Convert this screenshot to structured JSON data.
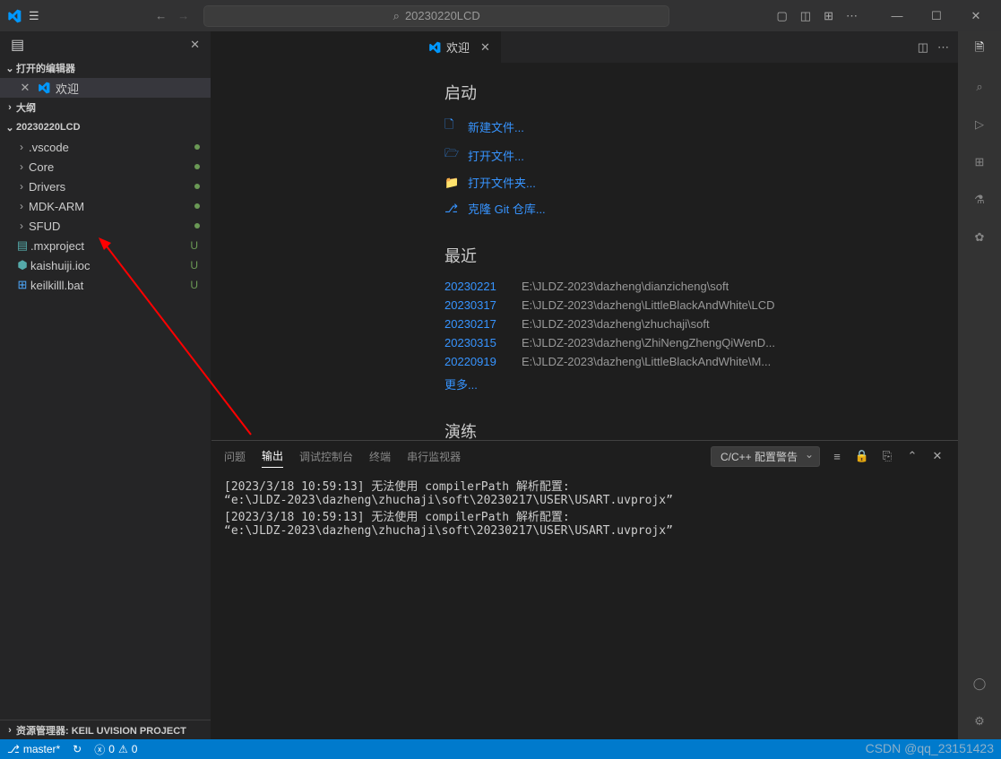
{
  "title": "20230220LCD",
  "search": {
    "placeholder": "20230220LCD"
  },
  "sidebar": {
    "open_editors_label": "打开的编辑器",
    "outline_label": "大纲",
    "project_label": "20230220LCD",
    "open_editor_item": {
      "label": "欢迎"
    },
    "items": [
      {
        "label": ".vscode",
        "type": "folder",
        "status": "dot"
      },
      {
        "label": "Core",
        "type": "folder",
        "status": "dot"
      },
      {
        "label": "Drivers",
        "type": "folder",
        "status": "dot"
      },
      {
        "label": "MDK-ARM",
        "type": "folder",
        "status": "dot"
      },
      {
        "label": "SFUD",
        "type": "folder",
        "status": "dot"
      },
      {
        "label": ".mxproject",
        "type": "file",
        "status": "U"
      },
      {
        "label": "kaishuiji.ioc",
        "type": "file",
        "status": "U"
      },
      {
        "label": "keilkilll.bat",
        "type": "file",
        "status": "U"
      }
    ],
    "bottom_label": "资源管理器: KEIL UVISION PROJECT"
  },
  "tab": {
    "label": "欢迎"
  },
  "welcome": {
    "start_heading": "启动",
    "actions": [
      {
        "icon": "new-file",
        "label": "新建文件..."
      },
      {
        "icon": "open-file",
        "label": "打开文件..."
      },
      {
        "icon": "folder",
        "label": "打开文件夹..."
      },
      {
        "icon": "git",
        "label": "克隆 Git 仓库..."
      }
    ],
    "recent_heading": "最近",
    "recent": [
      {
        "name": "20230221",
        "path": "E:\\JLDZ-2023\\dazheng\\dianzicheng\\soft"
      },
      {
        "name": "20230317",
        "path": "E:\\JLDZ-2023\\dazheng\\LittleBlackAndWhite\\LCD"
      },
      {
        "name": "20230217",
        "path": "E:\\JLDZ-2023\\dazheng\\zhuchaji\\soft"
      },
      {
        "name": "20230315",
        "path": "E:\\JLDZ-2023\\dazheng\\ZhiNengZhengQiWenD..."
      },
      {
        "name": "20220919",
        "path": "E:\\JLDZ-2023\\dazheng\\LittleBlackAndWhite\\M..."
      }
    ],
    "more_label": "更多...",
    "drill_heading": "演练"
  },
  "panel": {
    "tabs": [
      "问题",
      "输出",
      "调试控制台",
      "终端",
      "串行监视器"
    ],
    "active_tab": 1,
    "select_label": "C/C++ 配置警告",
    "output": "[2023/3/18 10:59:13] 无法使用 compilerPath 解析配置: \n“e:\\JLDZ-2023\\dazheng\\zhuchaji\\soft\\20230217\\USER\\USART.uvprojx”\n[2023/3/18 10:59:13] 无法使用 compilerPath 解析配置: \n“e:\\JLDZ-2023\\dazheng\\zhuchaji\\soft\\20230217\\USER\\USART.uvprojx”"
  },
  "statusbar": {
    "branch": "master*",
    "sync": "↻",
    "errors": "0",
    "warnings": "0"
  },
  "watermark": "CSDN @qq_23151423"
}
